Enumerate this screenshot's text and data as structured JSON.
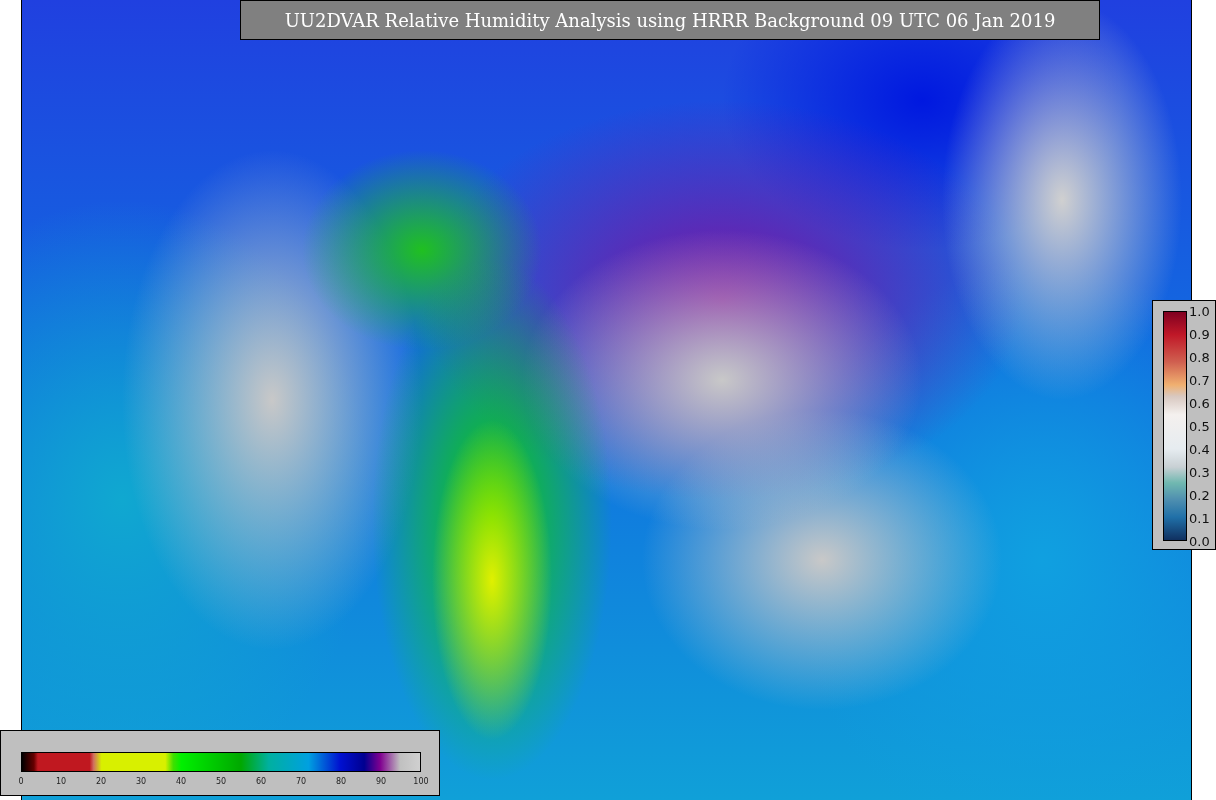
{
  "title": "UU2DVAR Relative Humidity Analysis using HRRR Background 09 UTC 06 Jan 2019",
  "colorbar_humidity": {
    "ticks": [
      "0",
      "10",
      "20",
      "30",
      "40",
      "50",
      "60",
      "70",
      "80",
      "90",
      "100"
    ]
  },
  "colorbar_innovation": {
    "ticks": [
      "1.0",
      "0.9",
      "0.8",
      "0.7",
      "0.6",
      "0.5",
      "0.4",
      "0.3",
      "0.2",
      "0.1",
      "0.0"
    ]
  }
}
